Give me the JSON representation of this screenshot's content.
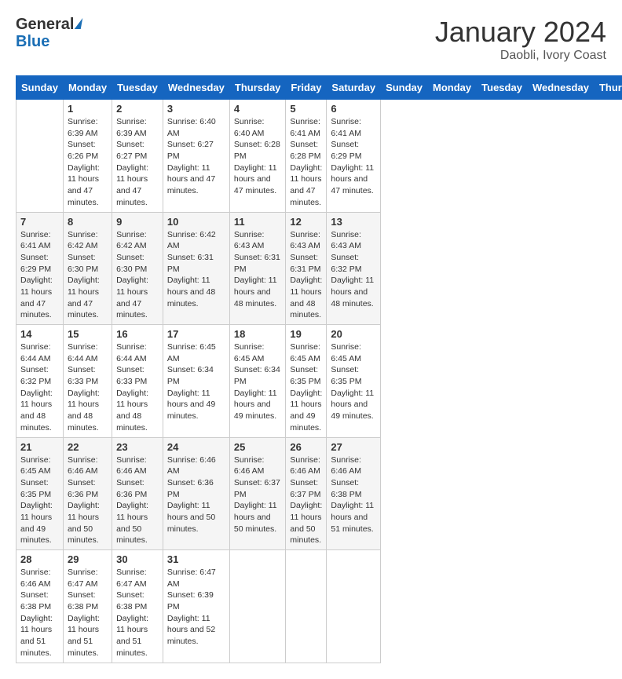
{
  "header": {
    "logo_general": "General",
    "logo_blue": "Blue",
    "month_title": "January 2024",
    "location": "Daobli, Ivory Coast"
  },
  "days_of_week": [
    "Sunday",
    "Monday",
    "Tuesday",
    "Wednesday",
    "Thursday",
    "Friday",
    "Saturday"
  ],
  "weeks": [
    [
      {
        "day": "",
        "info": ""
      },
      {
        "day": "1",
        "info": "Sunrise: 6:39 AM\nSunset: 6:26 PM\nDaylight: 11 hours and 47 minutes."
      },
      {
        "day": "2",
        "info": "Sunrise: 6:39 AM\nSunset: 6:27 PM\nDaylight: 11 hours and 47 minutes."
      },
      {
        "day": "3",
        "info": "Sunrise: 6:40 AM\nSunset: 6:27 PM\nDaylight: 11 hours and 47 minutes."
      },
      {
        "day": "4",
        "info": "Sunrise: 6:40 AM\nSunset: 6:28 PM\nDaylight: 11 hours and 47 minutes."
      },
      {
        "day": "5",
        "info": "Sunrise: 6:41 AM\nSunset: 6:28 PM\nDaylight: 11 hours and 47 minutes."
      },
      {
        "day": "6",
        "info": "Sunrise: 6:41 AM\nSunset: 6:29 PM\nDaylight: 11 hours and 47 minutes."
      }
    ],
    [
      {
        "day": "7",
        "info": "Sunrise: 6:41 AM\nSunset: 6:29 PM\nDaylight: 11 hours and 47 minutes."
      },
      {
        "day": "8",
        "info": "Sunrise: 6:42 AM\nSunset: 6:30 PM\nDaylight: 11 hours and 47 minutes."
      },
      {
        "day": "9",
        "info": "Sunrise: 6:42 AM\nSunset: 6:30 PM\nDaylight: 11 hours and 47 minutes."
      },
      {
        "day": "10",
        "info": "Sunrise: 6:42 AM\nSunset: 6:31 PM\nDaylight: 11 hours and 48 minutes."
      },
      {
        "day": "11",
        "info": "Sunrise: 6:43 AM\nSunset: 6:31 PM\nDaylight: 11 hours and 48 minutes."
      },
      {
        "day": "12",
        "info": "Sunrise: 6:43 AM\nSunset: 6:31 PM\nDaylight: 11 hours and 48 minutes."
      },
      {
        "day": "13",
        "info": "Sunrise: 6:43 AM\nSunset: 6:32 PM\nDaylight: 11 hours and 48 minutes."
      }
    ],
    [
      {
        "day": "14",
        "info": "Sunrise: 6:44 AM\nSunset: 6:32 PM\nDaylight: 11 hours and 48 minutes."
      },
      {
        "day": "15",
        "info": "Sunrise: 6:44 AM\nSunset: 6:33 PM\nDaylight: 11 hours and 48 minutes."
      },
      {
        "day": "16",
        "info": "Sunrise: 6:44 AM\nSunset: 6:33 PM\nDaylight: 11 hours and 48 minutes."
      },
      {
        "day": "17",
        "info": "Sunrise: 6:45 AM\nSunset: 6:34 PM\nDaylight: 11 hours and 49 minutes."
      },
      {
        "day": "18",
        "info": "Sunrise: 6:45 AM\nSunset: 6:34 PM\nDaylight: 11 hours and 49 minutes."
      },
      {
        "day": "19",
        "info": "Sunrise: 6:45 AM\nSunset: 6:35 PM\nDaylight: 11 hours and 49 minutes."
      },
      {
        "day": "20",
        "info": "Sunrise: 6:45 AM\nSunset: 6:35 PM\nDaylight: 11 hours and 49 minutes."
      }
    ],
    [
      {
        "day": "21",
        "info": "Sunrise: 6:45 AM\nSunset: 6:35 PM\nDaylight: 11 hours and 49 minutes."
      },
      {
        "day": "22",
        "info": "Sunrise: 6:46 AM\nSunset: 6:36 PM\nDaylight: 11 hours and 50 minutes."
      },
      {
        "day": "23",
        "info": "Sunrise: 6:46 AM\nSunset: 6:36 PM\nDaylight: 11 hours and 50 minutes."
      },
      {
        "day": "24",
        "info": "Sunrise: 6:46 AM\nSunset: 6:36 PM\nDaylight: 11 hours and 50 minutes."
      },
      {
        "day": "25",
        "info": "Sunrise: 6:46 AM\nSunset: 6:37 PM\nDaylight: 11 hours and 50 minutes."
      },
      {
        "day": "26",
        "info": "Sunrise: 6:46 AM\nSunset: 6:37 PM\nDaylight: 11 hours and 50 minutes."
      },
      {
        "day": "27",
        "info": "Sunrise: 6:46 AM\nSunset: 6:38 PM\nDaylight: 11 hours and 51 minutes."
      }
    ],
    [
      {
        "day": "28",
        "info": "Sunrise: 6:46 AM\nSunset: 6:38 PM\nDaylight: 11 hours and 51 minutes."
      },
      {
        "day": "29",
        "info": "Sunrise: 6:47 AM\nSunset: 6:38 PM\nDaylight: 11 hours and 51 minutes."
      },
      {
        "day": "30",
        "info": "Sunrise: 6:47 AM\nSunset: 6:38 PM\nDaylight: 11 hours and 51 minutes."
      },
      {
        "day": "31",
        "info": "Sunrise: 6:47 AM\nSunset: 6:39 PM\nDaylight: 11 hours and 52 minutes."
      },
      {
        "day": "",
        "info": ""
      },
      {
        "day": "",
        "info": ""
      },
      {
        "day": "",
        "info": ""
      }
    ]
  ]
}
